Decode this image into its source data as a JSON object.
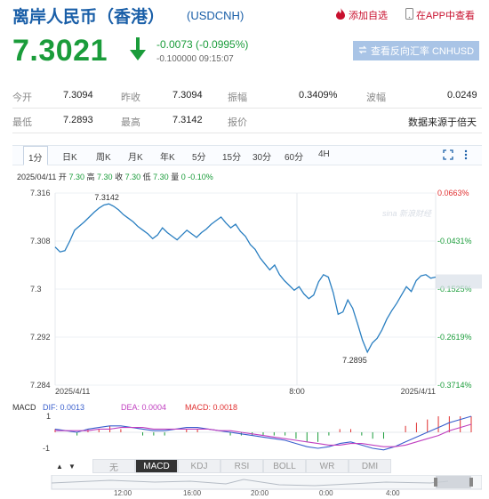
{
  "header": {
    "title": "离岸人民币（香港）",
    "code": "(USDCNH)",
    "add_watch": "添加自选",
    "app_view": "在APP中查看"
  },
  "quote": {
    "price": "7.3021",
    "change": "-0.0073 (-0.0995%)",
    "sub": "-0.100000 09:15:07",
    "reverse_btn": "查看反向汇率 CNHUSD"
  },
  "stats": {
    "open_label": "今开",
    "open": "7.3094",
    "prev_label": "昨收",
    "prev": "7.3094",
    "amp_label": "振幅",
    "amp": "0.3409%",
    "wave_label": "波幅",
    "wave": "0.0249",
    "low_label": "最低",
    "low": "7.2893",
    "high_label": "最高",
    "high": "7.3142",
    "quote_label": "报价",
    "quote_src": "数据来源于倍天"
  },
  "tabs": [
    "1分",
    "日K",
    "周K",
    "月K",
    "年K",
    "5分",
    "15分",
    "30分",
    "60分",
    "4H"
  ],
  "ohlc_text": {
    "date": "2025/04/11",
    "open_label": "开",
    "open": "7.30",
    "high_label": "高",
    "high": "7.30",
    "close_label": "收",
    "close": "7.30",
    "low_label": "低",
    "low": "7.30",
    "vol_label": "量",
    "vol": "0",
    "pct": "-0.10%"
  },
  "chart_data": {
    "type": "line",
    "y_ticks": [
      "7.316",
      "7.308",
      "7.3",
      "7.292",
      "7.284"
    ],
    "pct_ticks": [
      "0.0663%",
      "-0.0431%",
      "-0.1525%",
      "-0.2619%",
      "-0.3714%"
    ],
    "x_labels": [
      "2025/4/11",
      "8:00",
      "2025/4/11"
    ],
    "ylim": [
      7.284,
      7.316
    ],
    "high_label": "7.3142",
    "low_label": "7.2895",
    "watermark": "sina 新浪财经",
    "series": [
      {
        "values": [
          7.307,
          7.3062,
          7.3064,
          7.308,
          7.3098,
          7.3105,
          7.3112,
          7.312,
          7.3128,
          7.3135,
          7.314,
          7.3142,
          7.3138,
          7.3132,
          7.3124,
          7.3118,
          7.3112,
          7.3104,
          7.3098,
          7.3092,
          7.3084,
          7.309,
          7.3102,
          7.3094,
          7.3088,
          7.3082,
          7.309,
          7.3098,
          7.3092,
          7.3086,
          7.3094,
          7.31,
          7.3108,
          7.3114,
          7.312,
          7.311,
          7.3102,
          7.3108,
          7.3096,
          7.3088,
          7.3074,
          7.3066,
          7.3052,
          7.3042,
          7.3032,
          7.304,
          7.3024,
          7.3014,
          7.3006,
          7.2998,
          7.3004,
          7.2992,
          7.2984,
          7.299,
          7.3012,
          7.3024,
          7.302,
          7.2994,
          7.2958,
          7.2962,
          7.2982,
          7.2968,
          7.2942,
          7.2915,
          7.2895,
          7.291,
          7.2918,
          7.2932,
          7.295,
          7.2964,
          7.2976,
          7.299,
          7.3004,
          7.2996,
          7.3014,
          7.3022,
          7.3024,
          7.3018,
          7.302
        ]
      }
    ],
    "macd": {
      "label": "MACD",
      "dif_label": "DIF: 0.0013",
      "dea_label": "DEA: 0.0004",
      "macd_label": "MACD: 0.0018",
      "y_ticks": [
        "1",
        "-1"
      ],
      "dif": [
        0.2,
        0.1,
        0.0,
        0.2,
        0.3,
        0.4,
        0.4,
        0.3,
        0.2,
        0.1,
        0.1,
        0.2,
        0.3,
        0.3,
        0.2,
        0.1,
        0.0,
        -0.1,
        -0.2,
        -0.3,
        -0.4,
        -0.5,
        -0.7,
        -0.9,
        -1.0,
        -0.9,
        -0.7,
        -0.6,
        -0.8,
        -1.0,
        -1.1,
        -0.9,
        -0.6,
        -0.3,
        0.0,
        0.3,
        0.6,
        0.8,
        1.0
      ],
      "dea": [
        0.1,
        0.1,
        0.1,
        0.1,
        0.2,
        0.2,
        0.3,
        0.3,
        0.3,
        0.2,
        0.2,
        0.2,
        0.2,
        0.2,
        0.2,
        0.1,
        0.1,
        0.0,
        -0.1,
        -0.2,
        -0.3,
        -0.4,
        -0.5,
        -0.6,
        -0.7,
        -0.8,
        -0.8,
        -0.7,
        -0.7,
        -0.8,
        -0.9,
        -0.9,
        -0.8,
        -0.6,
        -0.4,
        -0.2,
        0.1,
        0.3,
        0.5
      ],
      "hist": [
        0.2,
        0.0,
        -0.2,
        0.2,
        0.2,
        0.4,
        0.2,
        0.0,
        -0.2,
        -0.2,
        -0.2,
        0.0,
        0.2,
        0.2,
        0.0,
        0.0,
        -0.2,
        -0.2,
        -0.2,
        -0.2,
        -0.2,
        -0.2,
        -0.4,
        -0.6,
        -0.6,
        -0.2,
        0.2,
        0.2,
        -0.2,
        -0.4,
        -0.4,
        0.0,
        0.4,
        0.6,
        0.8,
        1.0,
        1.0,
        1.0,
        1.0
      ]
    }
  },
  "indicators": [
    "无",
    "MACD",
    "KDJ",
    "RSI",
    "BOLL",
    "WR",
    "DMI"
  ],
  "indicator_active": "MACD",
  "navigator": {
    "labels": [
      "12:00",
      "16:00",
      "20:00",
      "0:00",
      "4:00"
    ]
  },
  "colors": {
    "accent_blue": "#1a5fa8",
    "down_green": "#1a9c3a",
    "up_red": "#e03030",
    "line": "#2a7fc1",
    "dif": "#3a5fcd",
    "dea": "#c040c0"
  }
}
